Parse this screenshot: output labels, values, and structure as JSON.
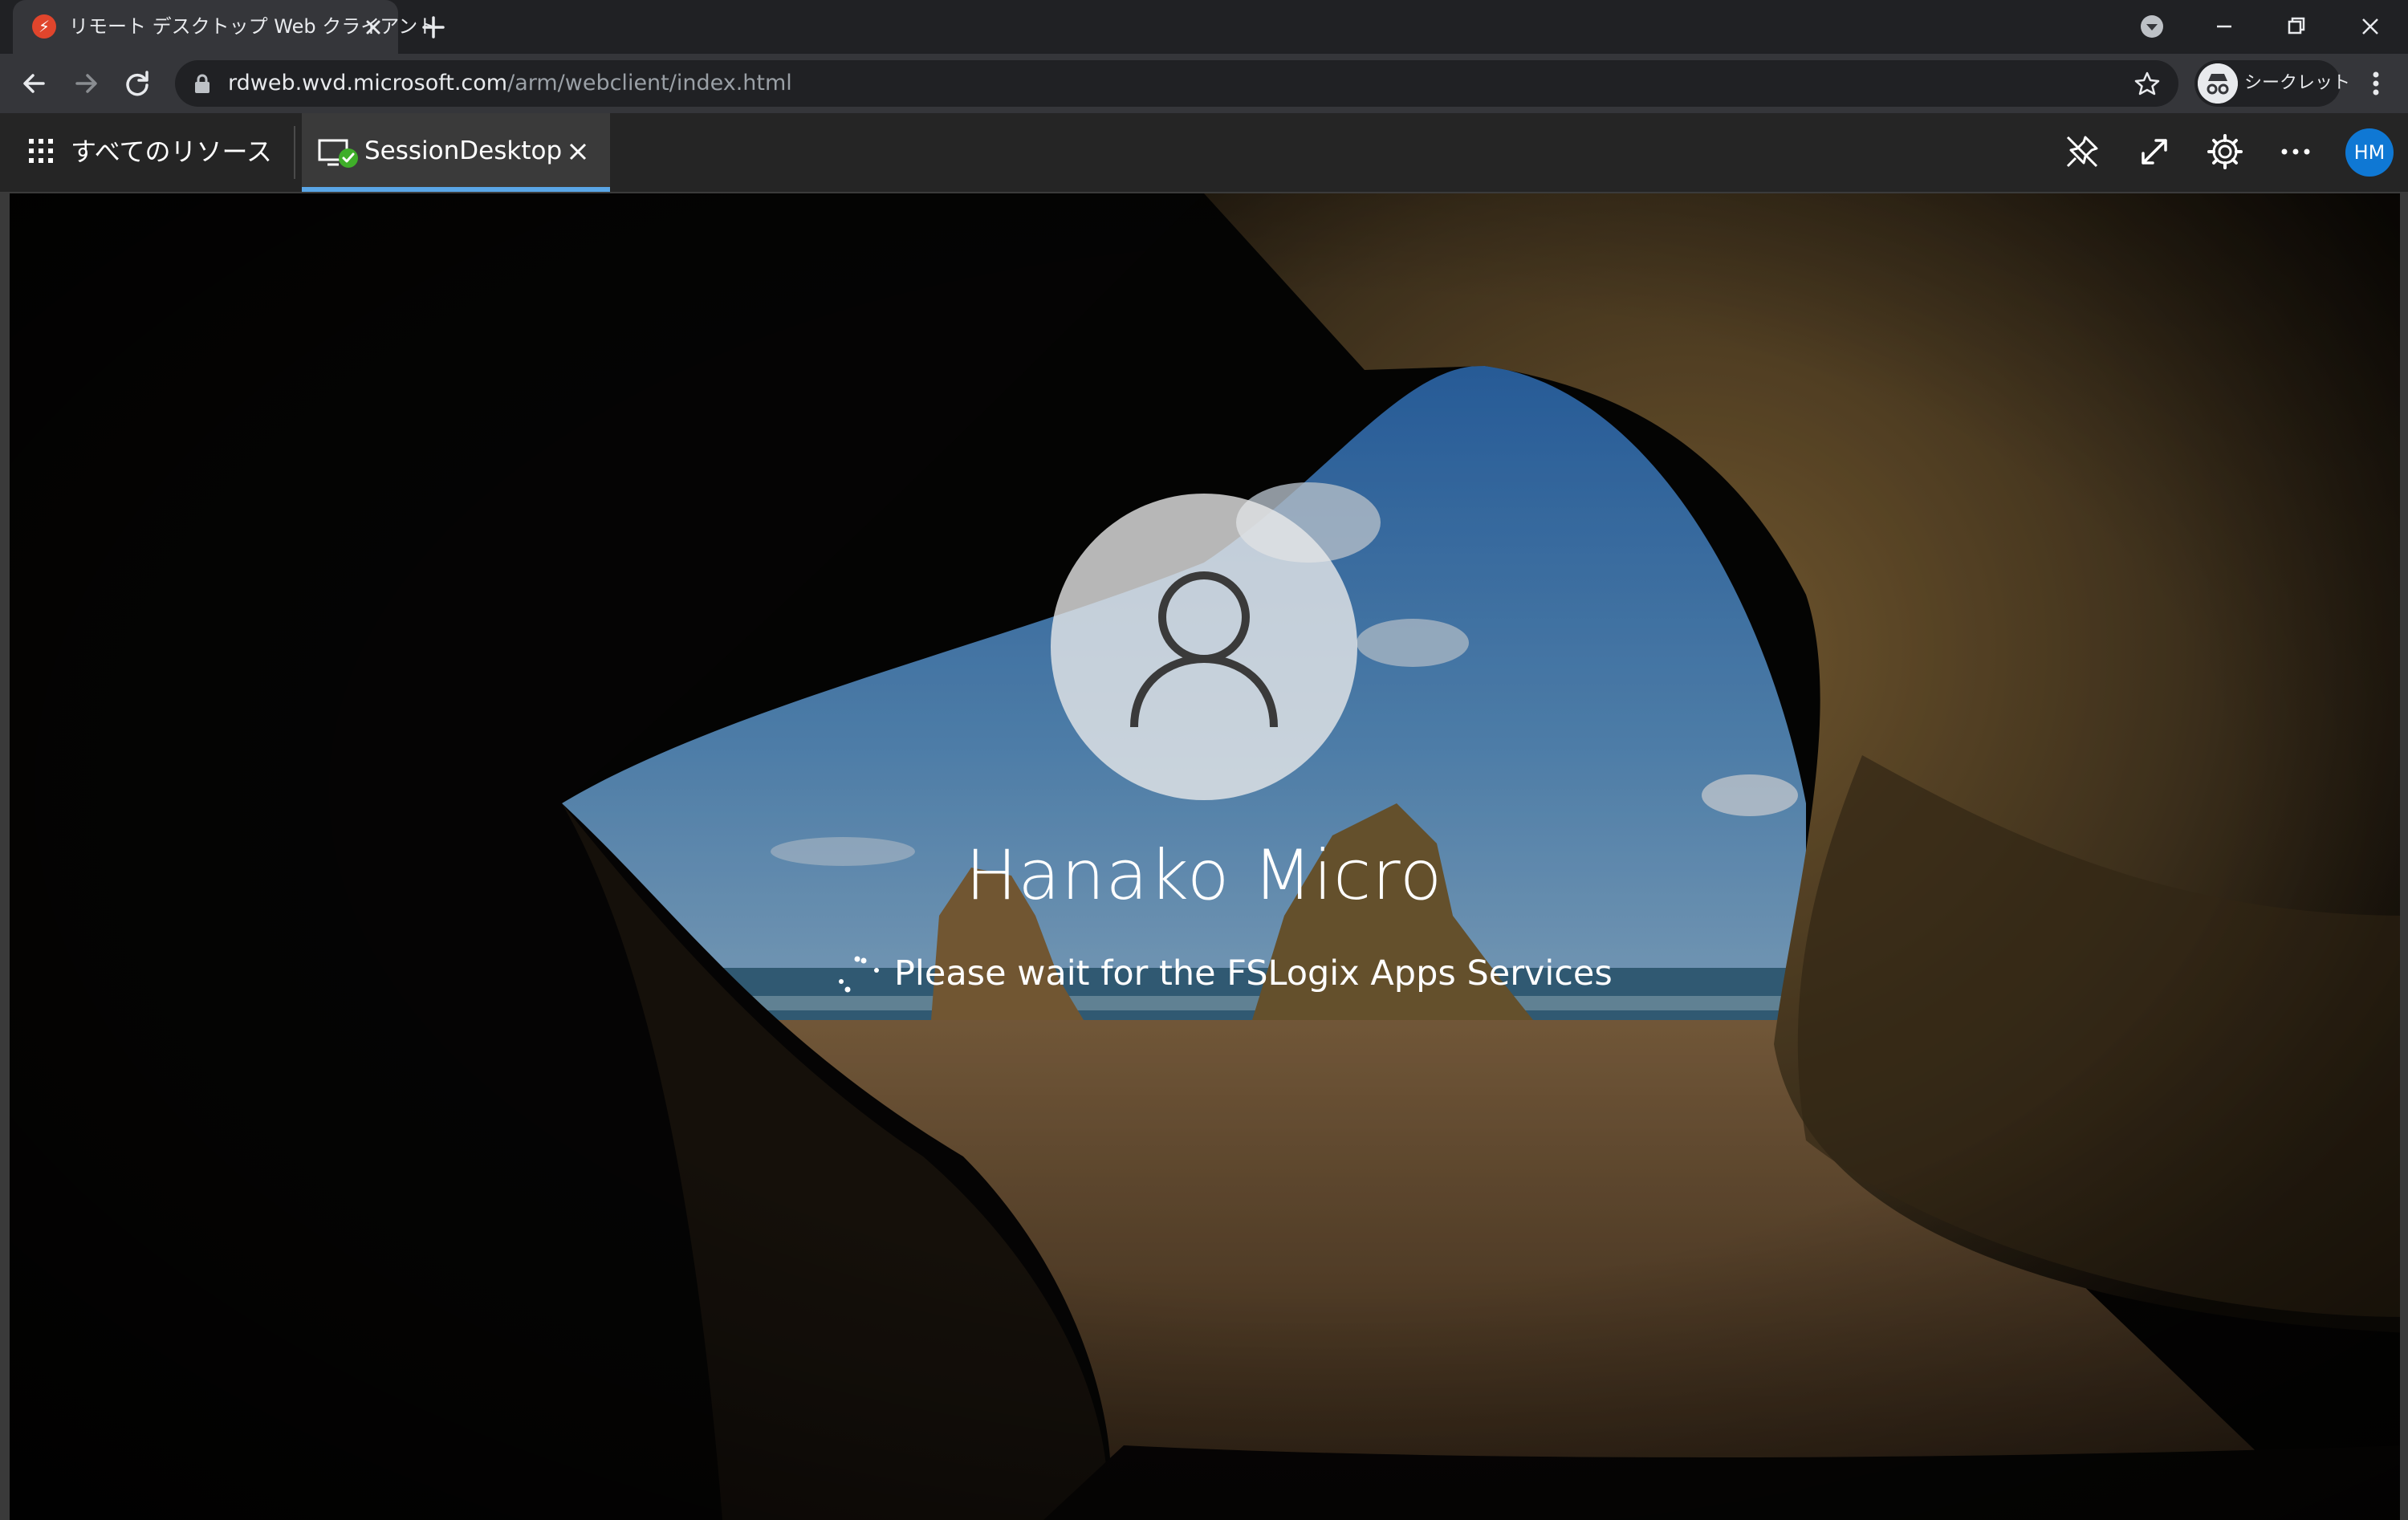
{
  "browser": {
    "tab_title": "リモート デスクトップ Web クライアント",
    "url_host": "rdweb.wvd.microsoft.com",
    "url_path": "/arm/webclient/index.html",
    "incognito_label": "シークレット"
  },
  "rdclient": {
    "all_resources_label": "すべてのリソース",
    "session_tab_label": "SessionDesktop",
    "avatar_initials": "HM",
    "accent_color": "#5aa6e6",
    "avatar_color": "#0f78d4"
  },
  "remote_screen": {
    "user_name": "Hanako Micro",
    "status_text": "Please wait for the FSLogix Apps Services"
  }
}
